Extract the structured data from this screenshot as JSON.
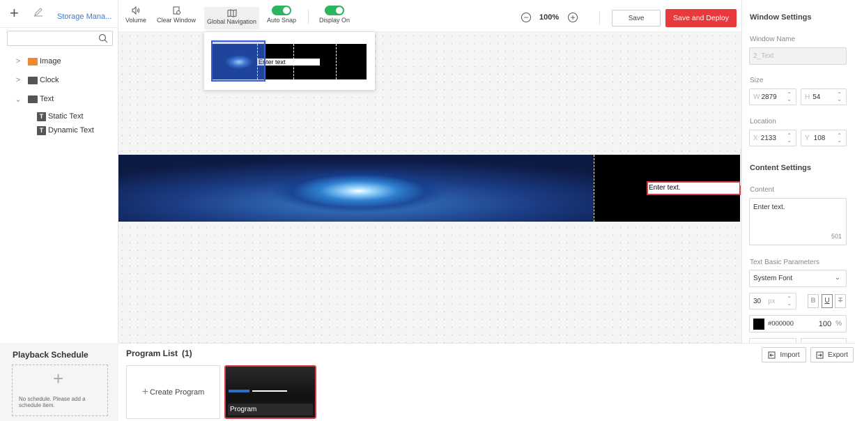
{
  "left": {
    "storage_label": "Storage Mana...",
    "search_placeholder": "",
    "tree": [
      {
        "label": "Image",
        "expanded": false
      },
      {
        "label": "Clock",
        "expanded": false
      },
      {
        "label": "Text",
        "expanded": true,
        "children": [
          "Static Text",
          "Dynamic Text"
        ]
      }
    ]
  },
  "toolbar": {
    "volume": "Volume",
    "clear_window": "Clear Window",
    "global_navigation": "Global Navigation",
    "auto_snap": "Auto Snap",
    "display_on": "Display On",
    "zoom": "100%",
    "save": "Save",
    "save_deploy": "Save and Deploy"
  },
  "canvas": {
    "text_content": "Enter text.",
    "nav_text": "Enter text"
  },
  "right": {
    "window_settings": "Window Settings",
    "window_name_label": "Window Name",
    "window_name": "2_Text",
    "size_label": "Size",
    "w_prefix": "W",
    "w_value": "2879",
    "h_prefix": "H",
    "h_value": "54",
    "location_label": "Location",
    "x_prefix": "X",
    "x_value": "2133",
    "y_prefix": "Y",
    "y_value": "108",
    "content_settings": "Content Settings",
    "content_label": "Content",
    "content_value": "Enter text.",
    "char_count": "501",
    "text_basic_params": "Text Basic Parameters",
    "font": "System Font",
    "font_size": "30",
    "font_unit": "px",
    "color_hex": "#000000",
    "opacity": "100",
    "opacity_unit": "%",
    "color_value": "#000000"
  },
  "bottom": {
    "playback_schedule": "Playback Schedule",
    "no_schedule": "No schedule. Please add a schedule item.",
    "program_list": "Program List",
    "program_count": "(1)",
    "create_program": "Create Program",
    "program_name": "Program",
    "import": "Import",
    "export": "Export"
  },
  "colors": {
    "accent": "#3a7bd5",
    "deploy": "#e8393d",
    "toggle_on": "#2db55d",
    "selection": "#d83b3f"
  }
}
